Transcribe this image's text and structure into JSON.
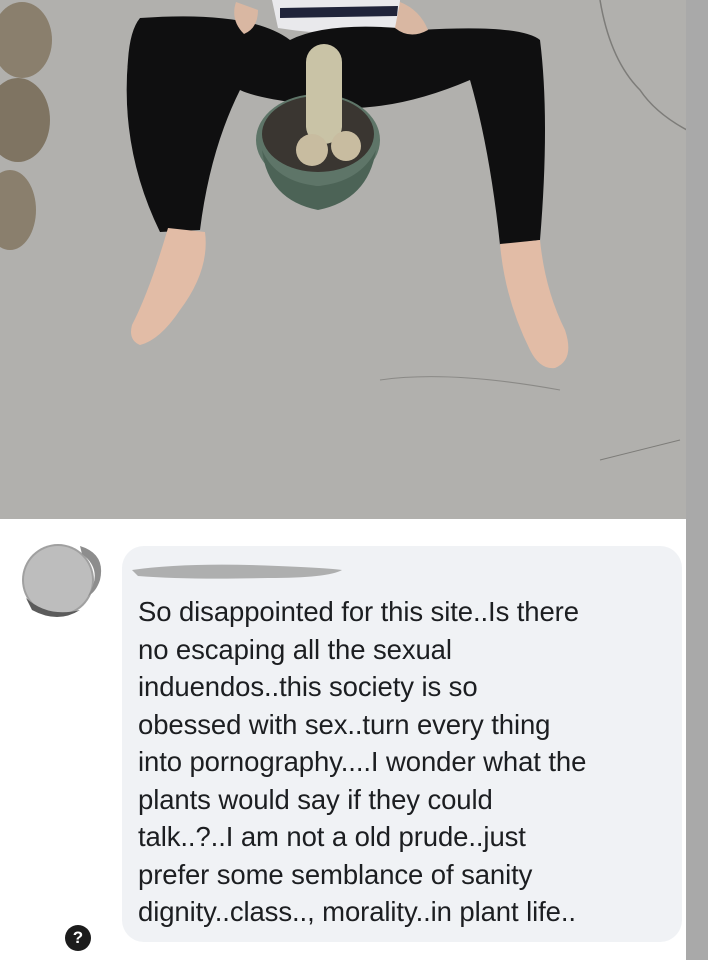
{
  "post": {
    "photo_icon": "photo"
  },
  "comment": {
    "author_icon": "avatar-blurred",
    "author_name": "",
    "text": "So disappointed for this site..Is there\nno escaping all the sexual\ninduendos..this society is so\nobessed with sex..turn every thing\ninto pornography....I wonder what the\nplants would say if they could\ntalk..?..I am not a old prude..just\nprefer some semblance of sanity\ndignity..class.., morality..in plant life.."
  },
  "help": {
    "label": "?"
  },
  "colors": {
    "bubble": "#f0f2f5",
    "text": "#1c1e21",
    "scroll_edge": "#a9a9a9"
  }
}
